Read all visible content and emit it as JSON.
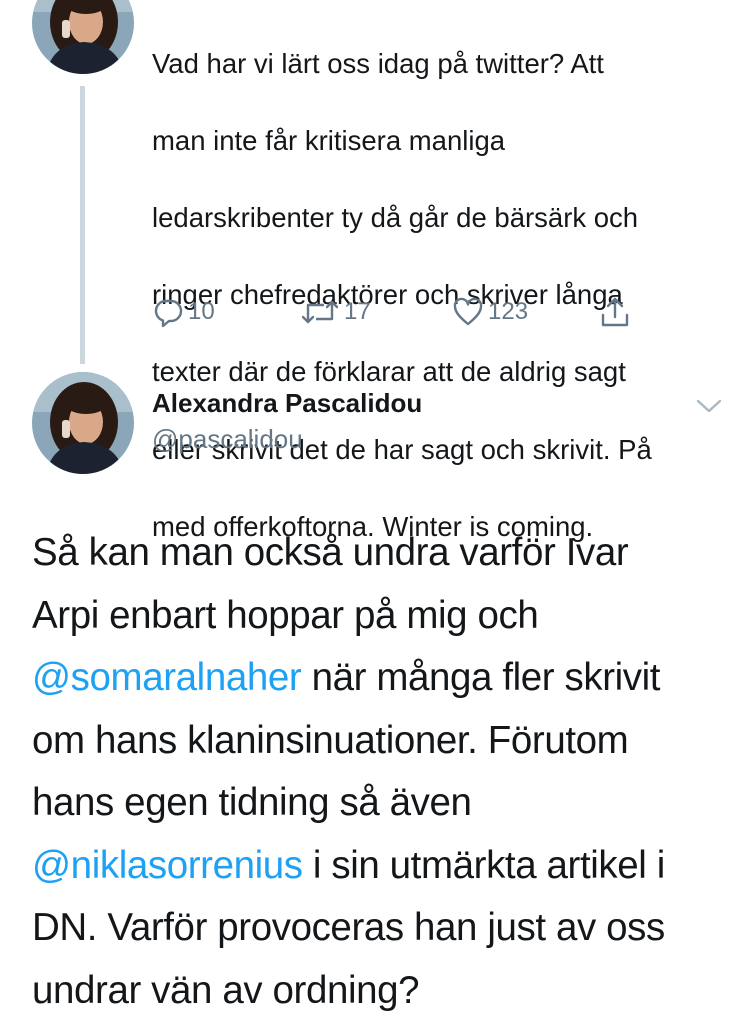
{
  "previous_tweet": {
    "text_lines": [
      "Vad har vi lärt oss idag på twitter? Att",
      "man inte får kritisera manliga",
      "ledarskribenter ty då går de bärsärk och",
      "ringer chefredaktörer och skriver långa",
      "texter där de förklarar att de aldrig sagt",
      "eller skrivit det de har sagt och skrivit. På",
      "med offerkoftorna. Winter is coming."
    ],
    "actions": {
      "reply": {
        "icon": "reply-icon",
        "count": "10"
      },
      "retweet": {
        "icon": "retweet-icon",
        "count": "17"
      },
      "like": {
        "icon": "heart-icon",
        "count": "123"
      },
      "share": {
        "icon": "share-icon"
      }
    }
  },
  "main_tweet": {
    "author": {
      "name": "Alexandra Pascalidou",
      "handle": "@pascalidou"
    },
    "menu_icon": "chevron-down-icon",
    "text_lines": [
      {
        "parts": [
          {
            "text": "Så kan man också undra varför Ivar",
            "mention": false
          }
        ]
      },
      {
        "parts": [
          {
            "text": "Arpi enbart hoppar på mig och",
            "mention": false
          }
        ]
      },
      {
        "parts": [
          {
            "text": "@somaralnaher",
            "mention": true
          },
          {
            "text": " när många fler skrivit",
            "mention": false
          }
        ]
      },
      {
        "parts": [
          {
            "text": "om hans klaninsinuationer. Förutom",
            "mention": false
          }
        ]
      },
      {
        "parts": [
          {
            "text": "hans egen tidning så även",
            "mention": false
          }
        ]
      },
      {
        "parts": [
          {
            "text": "@niklasorrenius",
            "mention": true
          },
          {
            "text": " i sin utmärkta artikel i",
            "mention": false
          }
        ]
      },
      {
        "parts": [
          {
            "text": "DN. Varför provoceras han just av oss",
            "mention": false
          }
        ]
      },
      {
        "parts": [
          {
            "text": "undrar vän av ordning?",
            "mention": false
          }
        ]
      }
    ]
  },
  "colors": {
    "text": "#14171a",
    "secondary": "#657786",
    "mention": "#1da1f2",
    "thread_line": "#ccd6dd"
  }
}
